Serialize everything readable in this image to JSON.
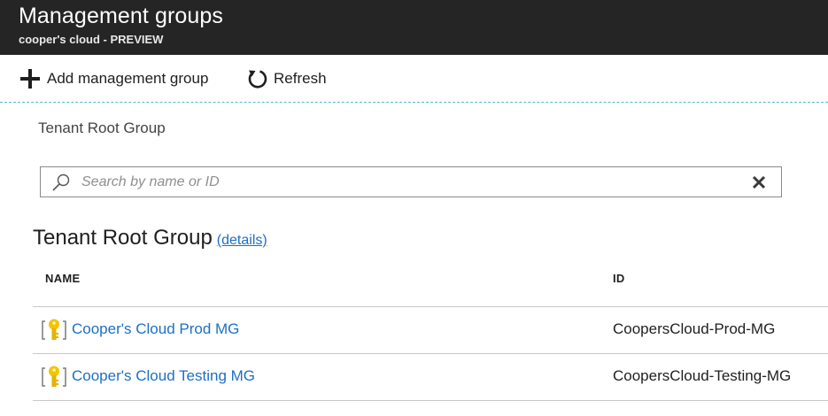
{
  "header": {
    "title": "Management groups",
    "subtitle": "cooper's cloud - PREVIEW"
  },
  "toolbar": {
    "add_label": "Add management group",
    "refresh_label": "Refresh"
  },
  "breadcrumb": "Tenant Root Group",
  "search": {
    "placeholder": "Search by name or ID",
    "value": ""
  },
  "section": {
    "title": "Tenant Root Group",
    "details_link": "(details)"
  },
  "table": {
    "columns": [
      "NAME",
      "ID"
    ],
    "rows": [
      {
        "name": "Cooper's Cloud Prod MG",
        "id": "CoopersCloud-Prod-MG",
        "icon": "management-group-key-icon"
      },
      {
        "name": "Cooper's Cloud Testing MG",
        "id": "CoopersCloud-Testing-MG",
        "icon": "management-group-key-icon"
      }
    ]
  },
  "colors": {
    "header_bg": "#252525",
    "link": "#1e6fc4",
    "accent_dashed": "#55b9c9",
    "icon_key": "#f5c400",
    "icon_bracket": "#7a7a7a"
  }
}
